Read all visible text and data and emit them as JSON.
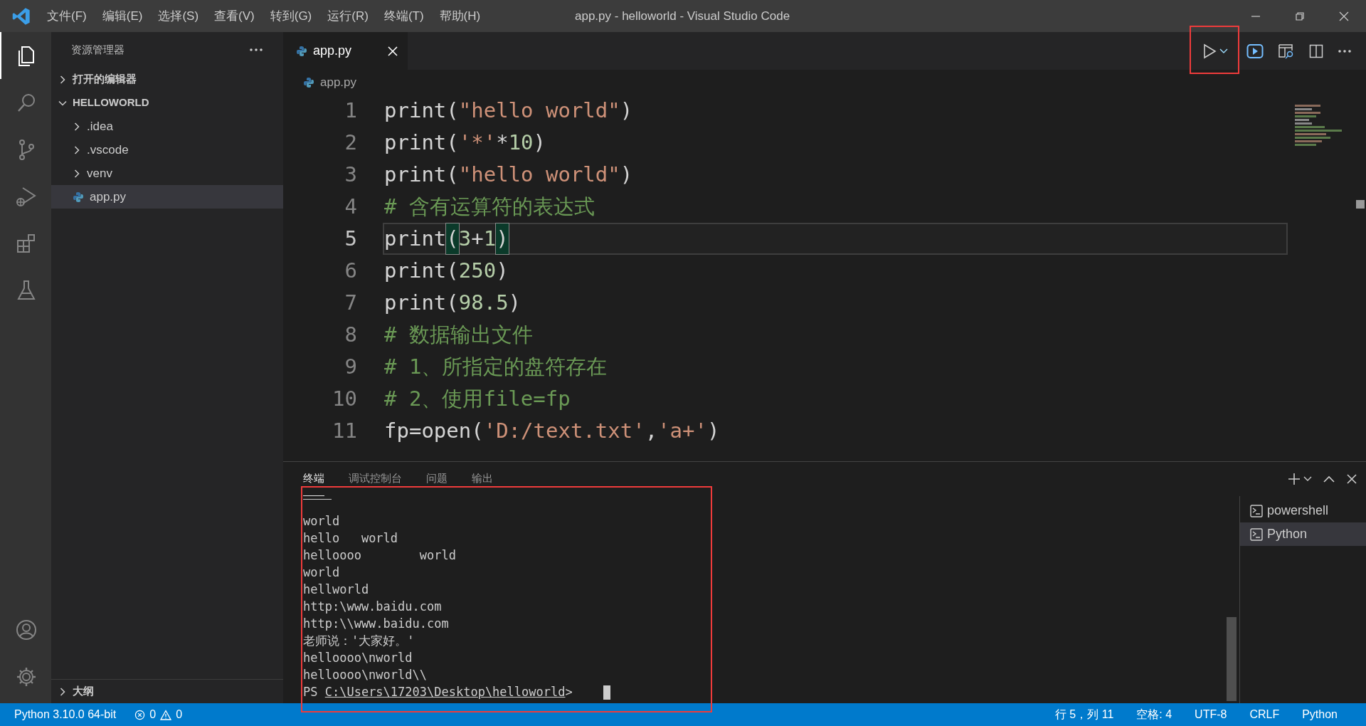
{
  "window": {
    "title": "app.py - helloworld - Visual Studio Code"
  },
  "menu": [
    "文件(F)",
    "编辑(E)",
    "选择(S)",
    "查看(V)",
    "转到(G)",
    "运行(R)",
    "终端(T)",
    "帮助(H)"
  ],
  "activity_bar": {
    "top": [
      {
        "kind": "files",
        "selected": true
      },
      {
        "kind": "search",
        "selected": false
      },
      {
        "kind": "source-control",
        "selected": false
      },
      {
        "kind": "run-debug",
        "selected": false
      },
      {
        "kind": "extensions",
        "selected": false
      },
      {
        "kind": "testing",
        "selected": false
      }
    ],
    "bottom": [
      {
        "kind": "account",
        "selected": false
      },
      {
        "kind": "settings",
        "selected": false
      }
    ]
  },
  "sidebar": {
    "title": "资源管理器",
    "sections": [
      {
        "label": "打开的编辑器",
        "expanded": false
      },
      {
        "label": "HELLOWORLD",
        "expanded": true,
        "items": [
          {
            "label": ".idea",
            "kind": "folder",
            "selected": false
          },
          {
            "label": ".vscode",
            "kind": "folder",
            "selected": false
          },
          {
            "label": "venv",
            "kind": "folder",
            "selected": false
          },
          {
            "label": "app.py",
            "kind": "python",
            "selected": true
          }
        ]
      }
    ],
    "outline": {
      "label": "大纲",
      "expanded": false
    }
  },
  "editor": {
    "tabs": [
      {
        "label": "app.py",
        "selected": true
      }
    ],
    "breadcrumb": "app.py",
    "lines": [
      {
        "number": "1",
        "current": false,
        "tokens": [
          {
            "kind": "plain",
            "text": "print("
          },
          {
            "kind": "string",
            "text": "\"hello world\""
          },
          {
            "kind": "plain",
            "text": ")"
          }
        ]
      },
      {
        "number": "2",
        "current": false,
        "tokens": [
          {
            "kind": "plain",
            "text": "print("
          },
          {
            "kind": "string",
            "text": "'*'"
          },
          {
            "kind": "plain",
            "text": "*"
          },
          {
            "kind": "number",
            "text": "10"
          },
          {
            "kind": "plain",
            "text": ")"
          }
        ]
      },
      {
        "number": "3",
        "current": false,
        "tokens": [
          {
            "kind": "plain",
            "text": "print("
          },
          {
            "kind": "string",
            "text": "\"hello world\""
          },
          {
            "kind": "plain",
            "text": ")"
          }
        ]
      },
      {
        "number": "4",
        "current": false,
        "tokens": [
          {
            "kind": "comment",
            "text": "# 含有运算符的表达式"
          }
        ]
      },
      {
        "number": "5",
        "current": true,
        "tokens": [
          {
            "kind": "plain",
            "text": "print"
          },
          {
            "kind": "bracket-match",
            "text": "("
          },
          {
            "kind": "number",
            "text": "3"
          },
          {
            "kind": "plain",
            "text": "+"
          },
          {
            "kind": "number",
            "text": "1"
          },
          {
            "kind": "bracket-match",
            "text": ")"
          }
        ]
      },
      {
        "number": "6",
        "current": false,
        "tokens": [
          {
            "kind": "plain",
            "text": "print("
          },
          {
            "kind": "number",
            "text": "250"
          },
          {
            "kind": "plain",
            "text": ")"
          }
        ]
      },
      {
        "number": "7",
        "current": false,
        "tokens": [
          {
            "kind": "plain",
            "text": "print("
          },
          {
            "kind": "number",
            "text": "98.5"
          },
          {
            "kind": "plain",
            "text": ")"
          }
        ]
      },
      {
        "number": "8",
        "current": false,
        "tokens": [
          {
            "kind": "comment",
            "text": "# 数据输出文件"
          }
        ]
      },
      {
        "number": "9",
        "current": false,
        "tokens": [
          {
            "kind": "comment",
            "text": "# 1、所指定的盘符存在"
          }
        ]
      },
      {
        "number": "10",
        "current": false,
        "tokens": [
          {
            "kind": "comment",
            "text": "# 2、使用file=fp"
          }
        ]
      },
      {
        "number": "11",
        "current": false,
        "tokens": [
          {
            "kind": "plain",
            "text": "fp=open("
          },
          {
            "kind": "string",
            "text": "'D:/text.txt'"
          },
          {
            "kind": "plain",
            "text": ","
          },
          {
            "kind": "string",
            "text": "'a+'"
          },
          {
            "kind": "plain",
            "text": ")"
          }
        ]
      }
    ]
  },
  "panel": {
    "tabs": [
      {
        "label": "终端",
        "selected": true
      },
      {
        "label": "调试控制台",
        "selected": false
      },
      {
        "label": "问题",
        "selected": false
      },
      {
        "label": "输出",
        "selected": false
      }
    ],
    "terminal_lines": [
      "world",
      "hello\tworld",
      "helloooo\tworld",
      "world",
      "hellworld",
      "http:\\www.baidu.com",
      "http:\\\\www.baidu.com",
      "老师说：'大家好。'",
      "helloooo\\nworld",
      "helloooo\\nworld\\\\"
    ],
    "prompt": {
      "prefix": "PS",
      "path": "C:\\Users\\17203\\Desktop\\helloworld",
      "suffix": ">"
    },
    "terminals": [
      {
        "label": "powershell",
        "selected": false
      },
      {
        "label": "Python",
        "selected": true
      }
    ]
  },
  "status_bar": {
    "interpreter": "Python 3.10.0 64-bit",
    "errors": "0",
    "warnings": "0",
    "right": [
      "行 5，列 11",
      "空格: 4",
      "UTF-8",
      "CRLF",
      "Python"
    ]
  }
}
